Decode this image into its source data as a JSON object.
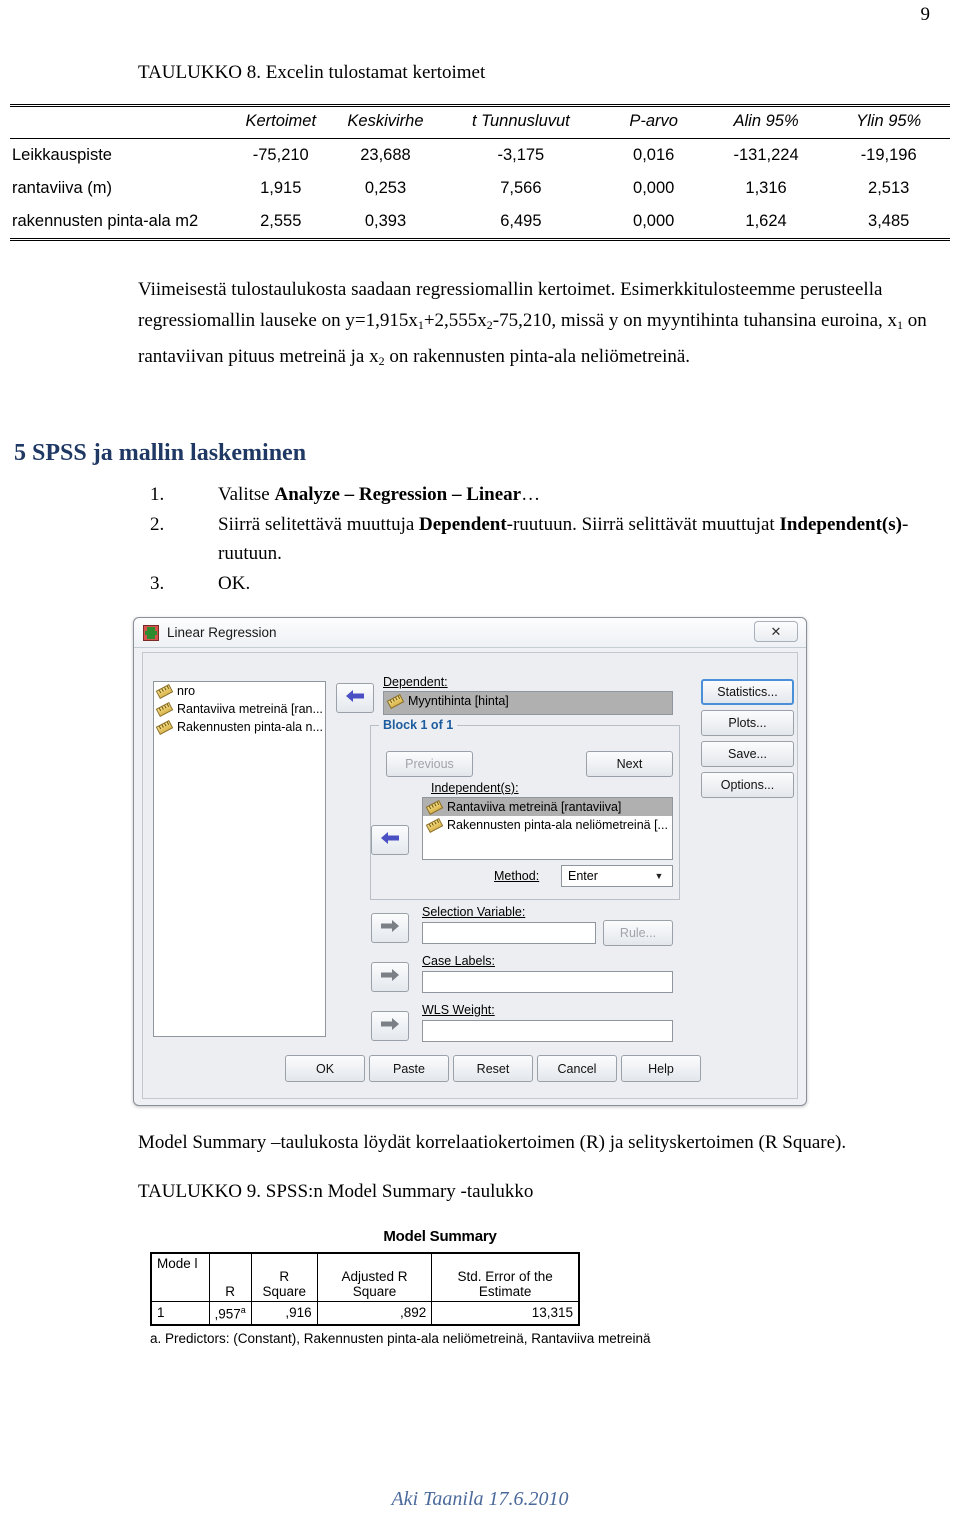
{
  "page": {
    "number": "9"
  },
  "table8": {
    "caption": "TAULUKKO 8. Excelin tulostamat kertoimet",
    "columns": [
      "",
      "Kertoimet",
      "Keskivirhe",
      "t Tunnusluvut",
      "P-arvo",
      "Alin 95%",
      "Ylin 95%"
    ],
    "rows": [
      {
        "label": "Leikkauspiste",
        "kertoimet": "-75,210",
        "keskivirhe": "23,688",
        "t": "-3,175",
        "p": "0,016",
        "alin": "-131,224",
        "ylin": "-19,196"
      },
      {
        "label": "rantaviiva (m)",
        "kertoimet": "1,915",
        "keskivirhe": "0,253",
        "t": "7,566",
        "p": "0,000",
        "alin": "1,316",
        "ylin": "2,513"
      },
      {
        "label": "rakennusten  pinta-ala m2",
        "kertoimet": "2,555",
        "keskivirhe": "0,393",
        "t": "6,495",
        "p": "0,000",
        "alin": "1,624",
        "ylin": "3,485"
      }
    ]
  },
  "paragraph": {
    "part1": "Viimeisestä tulostaulukosta saadaan regressiomallin kertoimet. Esimerkkitulosteemme perusteella regressiomallin lauseke on y=1,915x",
    "sub1": "1",
    "part2": "+2,555x",
    "sub2": "2",
    "part3": "-75,210, missä y on myyntihinta tuhansina euroina, x",
    "sub3": "1",
    "part4": " on rantaviivan pituus metreinä ja x",
    "sub4": "2",
    "part5": " on rakennusten pinta-ala neliömetreinä."
  },
  "section": {
    "heading": "5 SPSS ja mallin laskeminen",
    "heading_color": "#1F3864"
  },
  "steps": [
    {
      "num": "1.",
      "pre": "Valitse ",
      "bold": "Analyze – Regression – Linear",
      "post": "…"
    },
    {
      "num": "2.",
      "pre": "Siirrä selitettävä muuttuja ",
      "bold": "Dependent",
      "post": "-ruutuun. Siirrä selittävät muuttujat ",
      "bold2": "Independent(s)",
      "post2": "-ruutuun."
    },
    {
      "num": "3.",
      "pre": "OK.",
      "bold": "",
      "post": ""
    }
  ],
  "dialog": {
    "title": "Linear Regression",
    "close_glyph": "✕",
    "variables": [
      "nro",
      "Rantaviiva metreinä [ran...",
      "Rakennusten pinta-ala n..."
    ],
    "dependent_label": "Dependent:",
    "dependent_value": "Myyntihinta [hinta]",
    "block_title": "Block 1 of 1",
    "previous_label": "Previous",
    "next_label": "Next",
    "independents_label": "Independent(s):",
    "independents": [
      "Rantaviiva metreinä [rantaviiva]",
      "Rakennusten pinta-ala neliömetreinä [..."
    ],
    "method_label": "Method:",
    "method_value": "Enter",
    "selection_variable_label": "Selection Variable:",
    "selection_variable_value": "",
    "rule_label": "Rule...",
    "case_labels_label": "Case Labels:",
    "case_labels_value": "",
    "wls_weight_label": "WLS Weight:",
    "wls_weight_value": "",
    "side_buttons": [
      "Statistics...",
      "Plots...",
      "Save...",
      "Options..."
    ],
    "bottom_buttons": [
      "OK",
      "Paste",
      "Reset",
      "Cancel",
      "Help"
    ],
    "arrow_left_glyph": "➡",
    "arrow_right_glyph": "➡",
    "combo_arrow_glyph": "▼"
  },
  "mid_text": "Model Summary –taulukosta löydät korrelaatiokertoimen (R) ja selityskertoimen (R Square).",
  "table9": {
    "caption": "TAULUKKO 9. SPSS:n Model Summary -taulukko",
    "title": "Model Summary",
    "columns": [
      "Mode l",
      "R",
      "R Square",
      "Adjusted R Square",
      "Std. Error of the Estimate"
    ],
    "row": {
      "model": "1",
      "r": ",957",
      "r_sup": "a",
      "r_square": ",916",
      "adj_r_square": ",892",
      "std_error": "13,315"
    },
    "note": "a. Predictors: (Constant), Rakennusten pinta-ala neliömetreinä, Rantaviiva metreinä"
  },
  "footer": {
    "text": "Aki Taanila 17.6.2010",
    "color": "#4b6a9b"
  }
}
